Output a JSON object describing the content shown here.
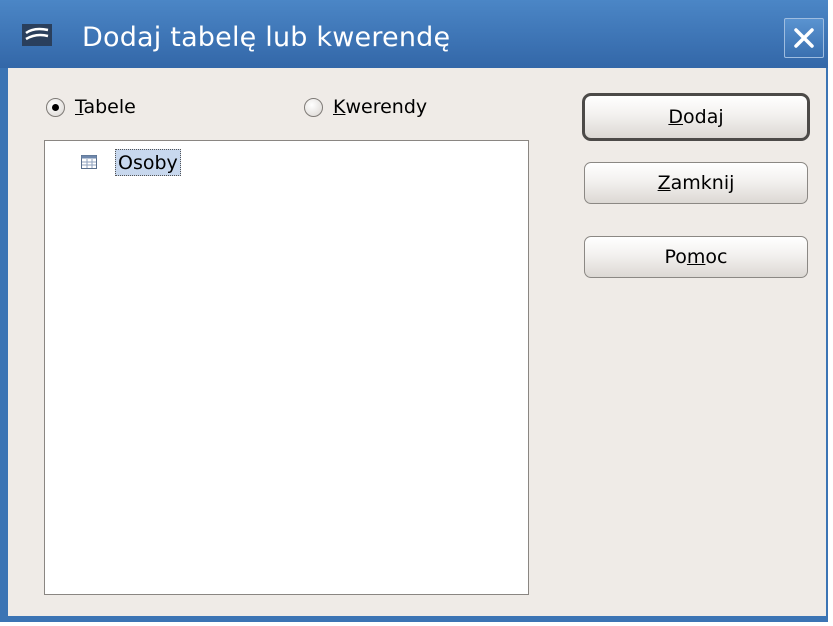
{
  "window": {
    "title": "Dodaj tabelę lub kwerendę",
    "app_icon": "office-app-icon",
    "close_icon": "close-icon"
  },
  "source_type": {
    "tables": {
      "label_mnemonic": "T",
      "label_rest": "abele",
      "checked": true
    },
    "queries": {
      "label_mnemonic": "K",
      "label_rest": "werendy",
      "checked": false
    }
  },
  "list": {
    "items": [
      {
        "label": "Osoby",
        "icon": "table-icon",
        "selected": true
      }
    ]
  },
  "buttons": {
    "add": {
      "pre": "",
      "mnemonic": "D",
      "post": "odaj"
    },
    "close": {
      "pre": "",
      "mnemonic": "Z",
      "post": "amknij"
    },
    "help": {
      "pre": "Po",
      "mnemonic": "m",
      "post": "oc"
    }
  },
  "colors": {
    "titlebar": "#3b74b4",
    "dialog_bg": "#efebe7",
    "selection": "#c8d8ee"
  }
}
